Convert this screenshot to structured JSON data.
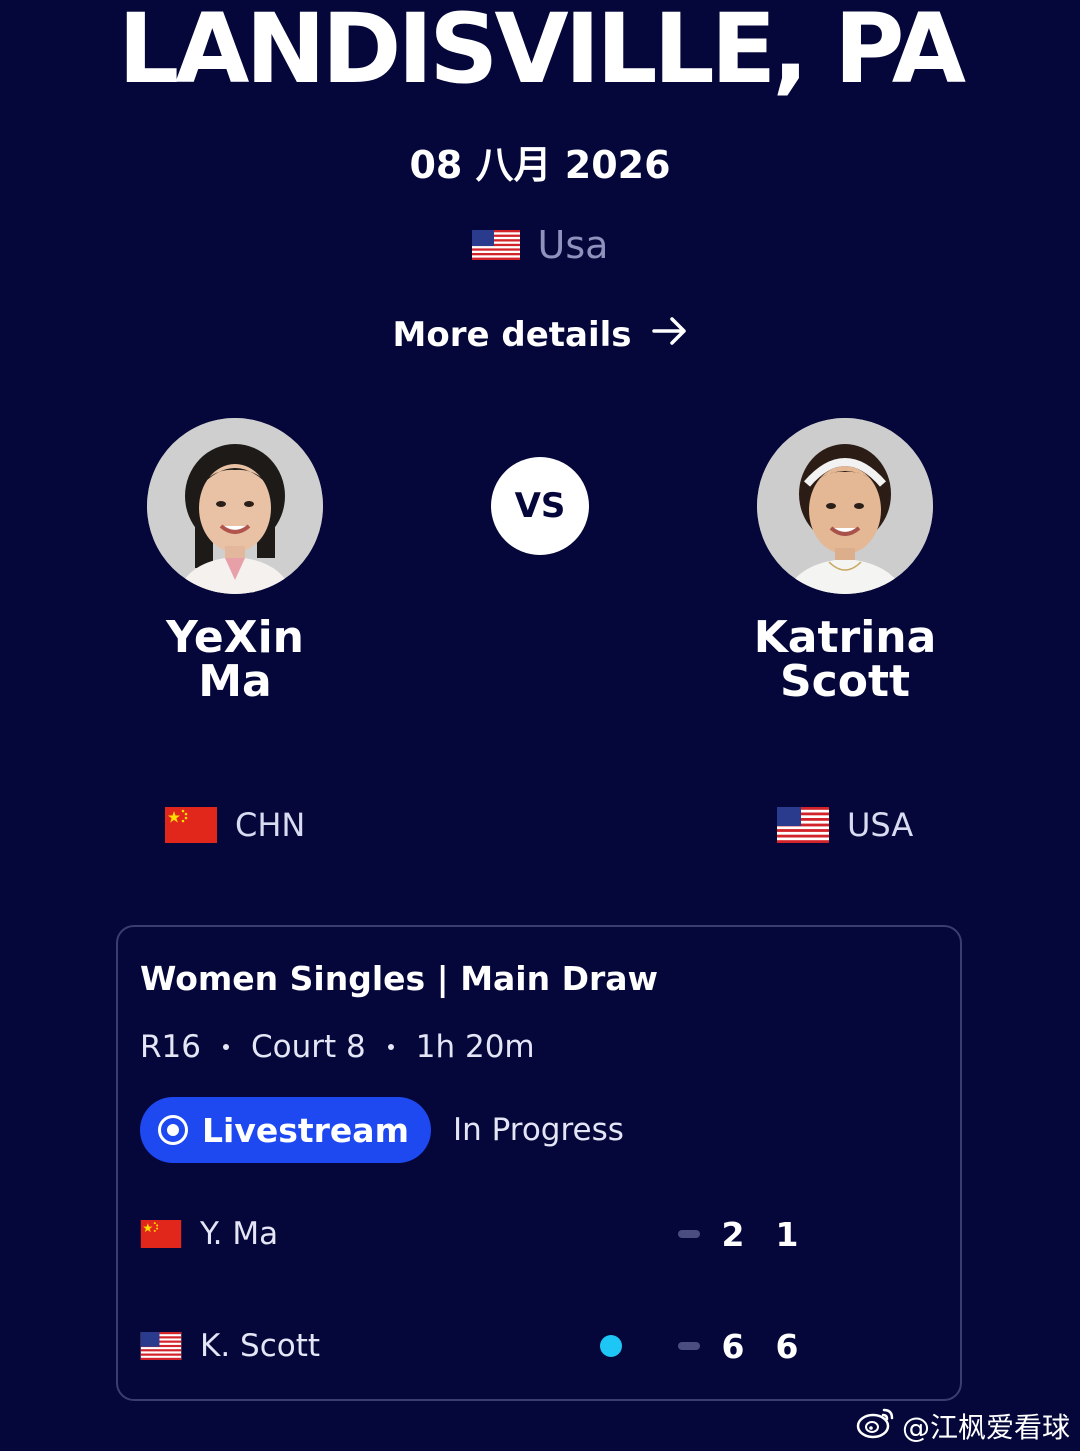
{
  "event": {
    "location": "LANDISVILLE, PA",
    "date": "08 八月 2026",
    "country": "Usa",
    "more_details_label": "More details"
  },
  "vs_label": "VS",
  "players": [
    {
      "first_name": "YeXin",
      "last_name": "Ma",
      "country": "CHN",
      "short_name": "Y. Ma",
      "sets": [
        "2",
        "1"
      ],
      "serving": false
    },
    {
      "first_name": "Katrina",
      "last_name": "Scott",
      "country": "USA",
      "short_name": "K. Scott",
      "sets": [
        "6",
        "6"
      ],
      "serving": true
    }
  ],
  "match": {
    "title": "Women Singles | Main Draw",
    "round": "R16",
    "court": "Court 8",
    "duration": "1h 20m",
    "livestream_label": "Livestream",
    "status": "In Progress"
  },
  "watermark": "@江枫爱看球",
  "colors": {
    "background": "#05073a",
    "livestream_button": "#1e48f0",
    "serve_indicator": "#1ec6f5",
    "card_border": "#3a3d70"
  }
}
